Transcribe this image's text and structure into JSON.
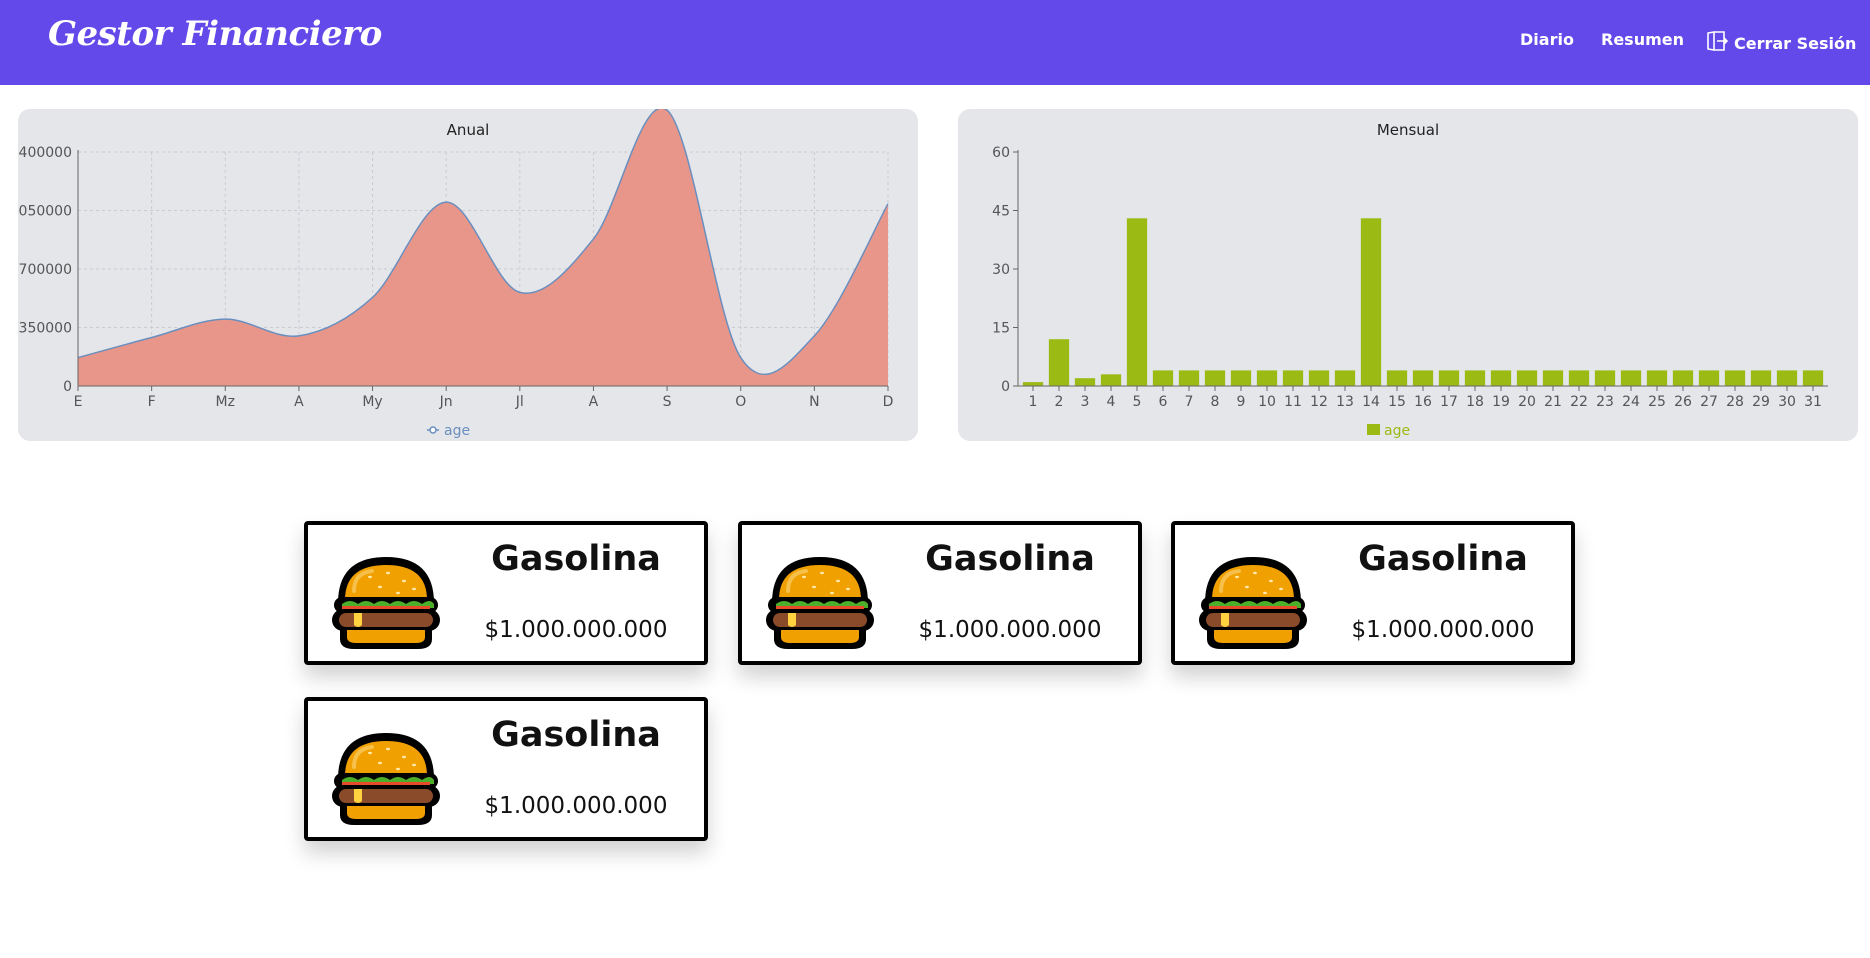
{
  "app": {
    "brand": "Gestor Financiero",
    "nav": {
      "diario": "Diario",
      "resumen": "Resumen",
      "logout": "Cerrar Sesión"
    },
    "colors": {
      "navbar": "#6449ea",
      "panel": "#e5e6ea",
      "area_fill": "#e9968a",
      "area_line": "#6a8fbf",
      "bar": "#9bbb14"
    }
  },
  "chart_data": [
    {
      "type": "area",
      "title": "Anual",
      "categories": [
        "E",
        "F",
        "Mz",
        "A",
        "My",
        "Jn",
        "Jl",
        "A",
        "S",
        "O",
        "N",
        "D"
      ],
      "series": [
        {
          "name": "age",
          "values": [
            170000,
            290000,
            400000,
            300000,
            530000,
            1100000,
            560000,
            880000,
            1650000,
            170000,
            300000,
            1090000
          ]
        }
      ],
      "ylim": [
        0,
        1400000
      ],
      "yticks": [
        0,
        350000,
        700000,
        1050000,
        1400000
      ],
      "ytick_labels": [
        "0",
        "350000",
        "700000",
        "050000",
        "400000"
      ],
      "grid": true,
      "legend": "bottom-center"
    },
    {
      "type": "bar",
      "title": "Mensual",
      "categories": [
        "1",
        "2",
        "3",
        "4",
        "5",
        "6",
        "7",
        "8",
        "9",
        "10",
        "11",
        "12",
        "13",
        "14",
        "15",
        "16",
        "17",
        "18",
        "19",
        "20",
        "21",
        "22",
        "23",
        "24",
        "25",
        "26",
        "27",
        "28",
        "29",
        "30",
        "31"
      ],
      "series": [
        {
          "name": "age",
          "values": [
            1,
            12,
            2,
            3,
            43,
            4,
            4,
            4,
            4,
            4,
            4,
            4,
            4,
            43,
            4,
            4,
            4,
            4,
            4,
            4,
            4,
            4,
            4,
            4,
            4,
            4,
            4,
            4,
            4,
            4,
            4
          ]
        }
      ],
      "ylim": [
        0,
        60
      ],
      "yticks": [
        0,
        15,
        30,
        45,
        60
      ],
      "grid": false,
      "legend": "bottom-center"
    }
  ],
  "cards": [
    {
      "title": "Gasolina",
      "amount": "$1.000.000.000",
      "icon": "burger-icon"
    },
    {
      "title": "Gasolina",
      "amount": "$1.000.000.000",
      "icon": "burger-icon"
    },
    {
      "title": "Gasolina",
      "amount": "$1.000.000.000",
      "icon": "burger-icon"
    },
    {
      "title": "Gasolina",
      "amount": "$1.000.000.000",
      "icon": "burger-icon"
    }
  ]
}
